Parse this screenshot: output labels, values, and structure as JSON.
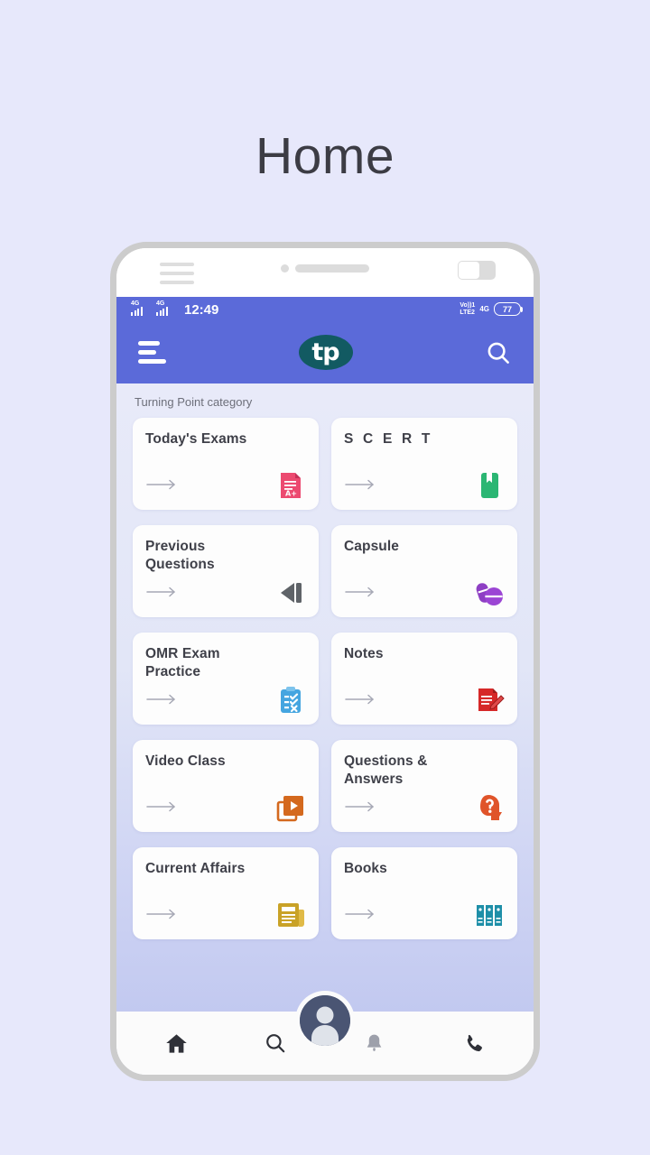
{
  "page": {
    "title": "Home",
    "background_color": "#e7e8fb"
  },
  "phone": {
    "frame_color": "#cccccc",
    "bezel": {
      "menu_icon": "hamburger-icon",
      "camera_icon": "camera-dot-icon",
      "speaker_icon": "speaker-grille-icon",
      "toggle_icon": "toggle-switch-icon"
    }
  },
  "statusbar": {
    "network_1": "4G",
    "network_2": "4G",
    "time": "12:49",
    "volte_line1": "Vo))1",
    "volte_line2": "LTE2",
    "network_right": "4G",
    "battery_level": "77"
  },
  "appbar": {
    "background_color": "#5b6ad9",
    "menu_icon": "hamburger-menu-icon",
    "logo_text": "tp",
    "logo_color": "#125a62",
    "search_icon": "search-icon"
  },
  "main": {
    "section_label": "Turning Point category",
    "arrow_icon": "arrow-right-icon",
    "cards": [
      {
        "title": "Today's Exams",
        "icon": "exam-paper-icon",
        "icon_color": "#ec4a70",
        "letter_spacing": false
      },
      {
        "title": "S C E R T",
        "icon": "bookmark-book-icon",
        "icon_color": "#2bb673",
        "letter_spacing": true
      },
      {
        "title": "Previous Questions",
        "icon": "rewind-back-icon",
        "icon_color": "#5f6368",
        "letter_spacing": false
      },
      {
        "title": "Capsule",
        "icon": "capsule-pills-icon",
        "icon_color": "#8e3fc4",
        "letter_spacing": false
      },
      {
        "title": "OMR Exam Practice",
        "icon": "clipboard-checklist-icon",
        "icon_color": "#45a5e0",
        "letter_spacing": false
      },
      {
        "title": "Notes",
        "icon": "notepad-pencil-icon",
        "icon_color": "#d62828",
        "letter_spacing": false
      },
      {
        "title": "Video Class",
        "icon": "video-player-icon",
        "icon_color": "#d4691e",
        "letter_spacing": false
      },
      {
        "title": "Questions & Answers",
        "icon": "head-question-icon",
        "icon_color": "#e0542a",
        "letter_spacing": false
      },
      {
        "title": "Current Affairs",
        "icon": "newspaper-icon",
        "icon_color": "#c9a227",
        "letter_spacing": false
      },
      {
        "title": "Books",
        "icon": "books-shelf-icon",
        "icon_color": "#1e8fa8",
        "letter_spacing": false
      }
    ]
  },
  "bottomnav": {
    "items": [
      {
        "icon": "home-icon",
        "label": "Home"
      },
      {
        "icon": "search-icon",
        "label": "Search"
      },
      {
        "icon": "profile-avatar-icon",
        "label": "Profile"
      },
      {
        "icon": "bell-notification-icon",
        "label": "Notifications"
      },
      {
        "icon": "phone-call-icon",
        "label": "Call"
      }
    ],
    "avatar_color": "#4a5573"
  }
}
